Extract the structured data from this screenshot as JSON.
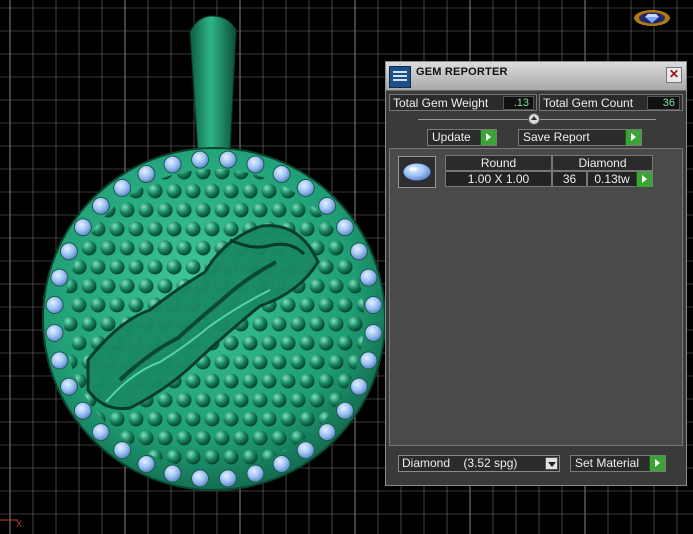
{
  "panel": {
    "title": "GEM REPORTER",
    "close_glyph": "✕",
    "total_gem_weight_label": "Total Gem Weight",
    "total_gem_weight_value": ".13",
    "total_gem_count_label": "Total Gem Count",
    "total_gem_count_value": "36",
    "update_label": "Update",
    "save_report_label": "Save Report",
    "table": {
      "columns": [
        "Round",
        "Diamond"
      ],
      "row": {
        "size": "1.00 X 1.00",
        "count": "36",
        "weight": "0.13tw"
      }
    },
    "material": {
      "selected_name": "Diamond",
      "selected_density": "(3.52 spg)"
    },
    "set_material_label": "Set Material"
  },
  "viewport": {
    "axis_marker": "X"
  },
  "icons": [
    "gem-reporter-logo-icon",
    "close-icon",
    "slider-knob-icon",
    "round-gem-icon",
    "dropdown-arrow-icon",
    "go-arrow-icon",
    "brand-logo-icon"
  ],
  "colors": {
    "background": "#000000",
    "grid": "#6e6e6e",
    "model_green": "#1f9e76",
    "gem_blue": "#9ec3f5",
    "panel": "#3a3a3a",
    "value_text": "#7de0a0",
    "go_button": "#3aa437"
  }
}
